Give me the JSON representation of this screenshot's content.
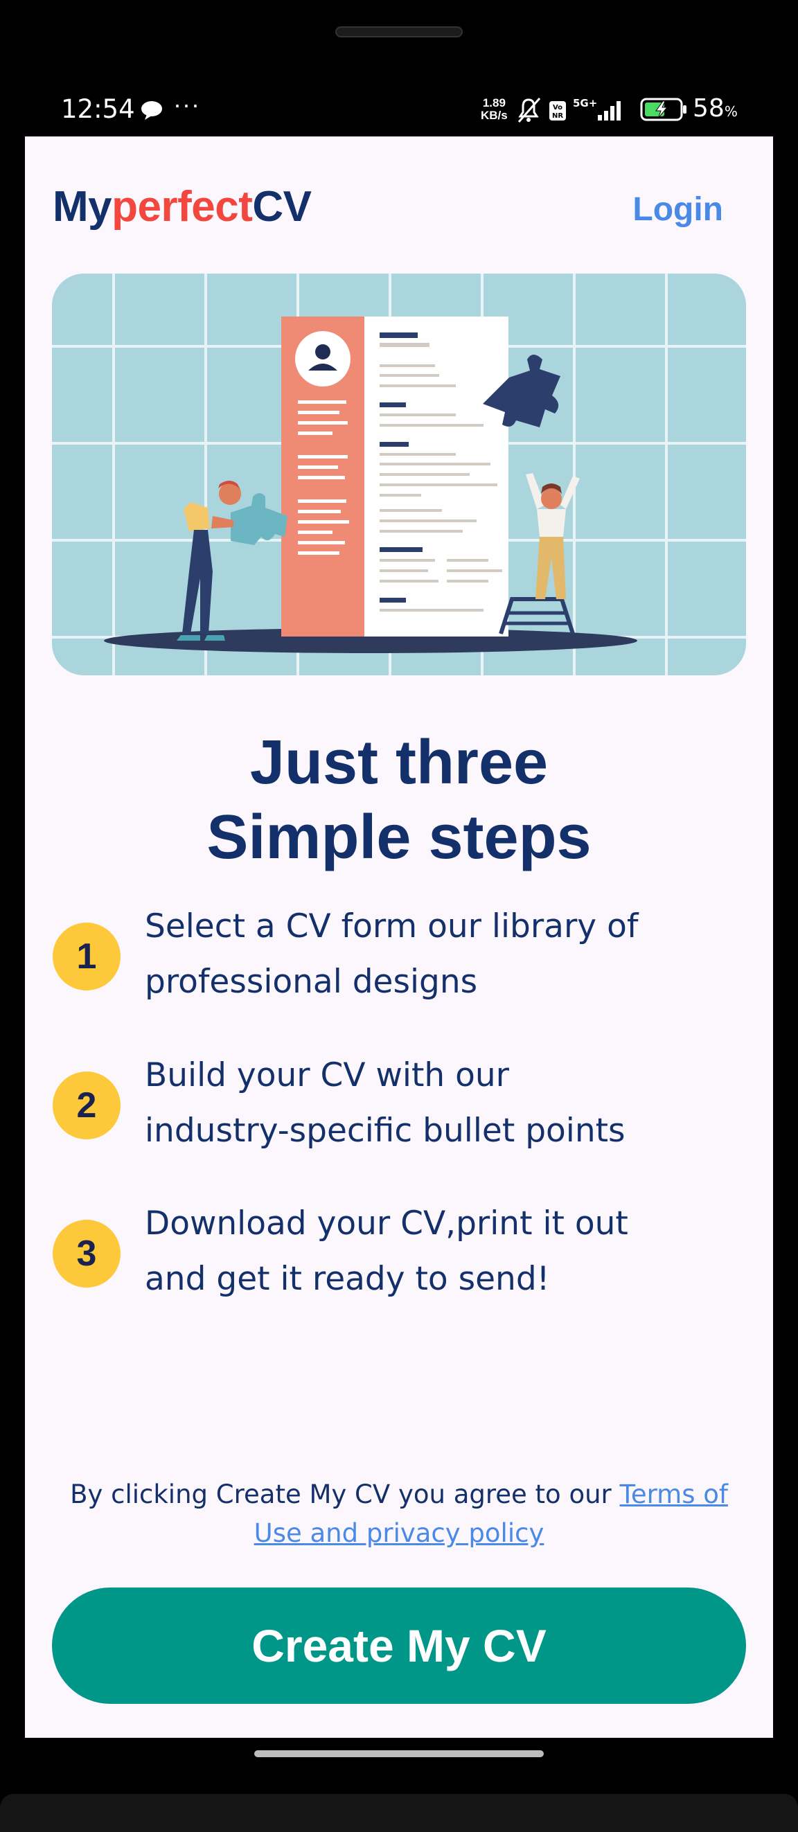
{
  "status_bar": {
    "time": "12:54",
    "more": "···",
    "net_speed_value": "1.89",
    "net_speed_unit": "KB/s",
    "network_type": "5G+",
    "volte_badge": "Vo NR",
    "battery_percent": "58",
    "battery_percent_sign": "%"
  },
  "header": {
    "logo_part1": "My",
    "logo_part2": "perfect",
    "logo_part3": "CV",
    "login_label": "Login"
  },
  "hero": {
    "image": "resume-puzzle-illustration"
  },
  "headline": {
    "line1": "Just three",
    "line2": "Simple steps"
  },
  "steps": [
    {
      "number": "1",
      "line1": "Select a CV form our library of",
      "line2": "professional designs"
    },
    {
      "number": "2",
      "line1": "Build your CV with our",
      "line2": "industry-specific bullet points"
    },
    {
      "number": "3",
      "line1": "Download your CV,print it out",
      "line2": "and get it ready to send!"
    }
  ],
  "terms": {
    "text": "By clicking Create My CV you agree to our ",
    "link_line1": "Terms of",
    "link_line2": "Use and privacy policy"
  },
  "cta": {
    "label": "Create My CV"
  },
  "colors": {
    "brand_navy": "#14306b",
    "brand_red": "#f2473f",
    "link_blue": "#4a8ae6",
    "cta_teal": "#009688",
    "step_badge_yellow": "#fdc93a",
    "screen_bg": "#fcf6fd"
  }
}
